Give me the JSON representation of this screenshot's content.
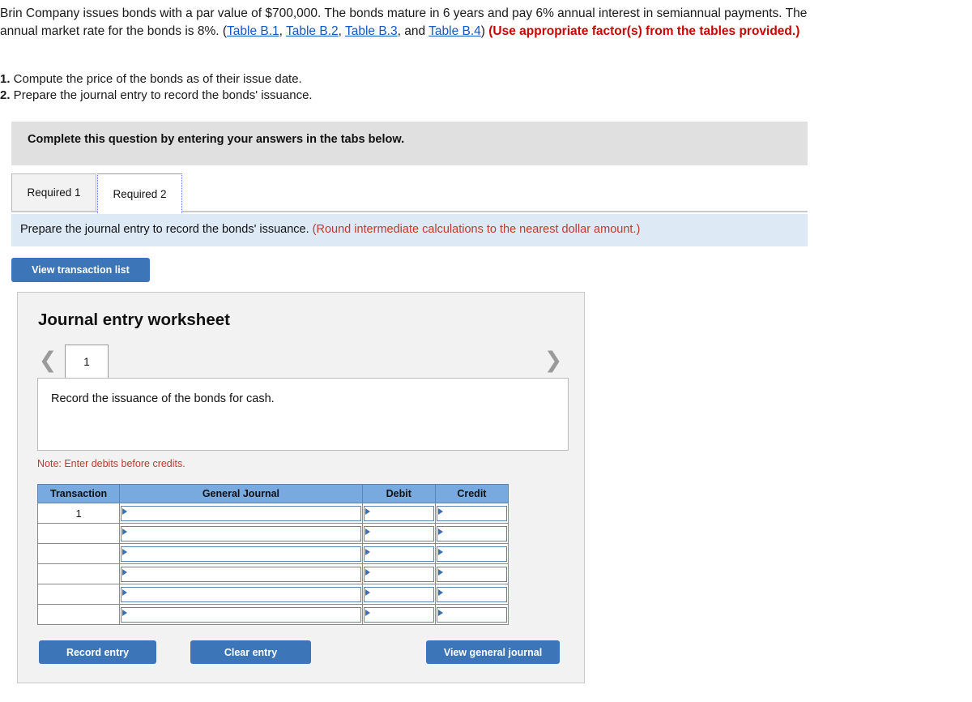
{
  "problem": {
    "part1": "Brin Company issues bonds with a par value of $700,000. The bonds mature in 6 years and pay 6% annual interest in semiannual payments. The annual market rate for the bonds is 8%. (",
    "link1": "Table B.1",
    "sep1": ", ",
    "link2": "Table B.2",
    "sep2": ", ",
    "link3": "Table B.3",
    "sep3": ", and ",
    "link4": "Table B.4",
    "part2": ") ",
    "emphasis": "(Use appropriate factor(s) from the tables provided.)"
  },
  "requirements": [
    {
      "num": "1.",
      "text": " Compute the price of the bonds as of their issue date."
    },
    {
      "num": "2.",
      "text": " Prepare the journal entry to record the bonds' issuance."
    }
  ],
  "complete_bar": {
    "text": "Complete this question by entering your answers in the tabs below."
  },
  "tabs": [
    {
      "label": "Required 1",
      "active": false
    },
    {
      "label": "Required 2",
      "active": true
    }
  ],
  "blue_bar": {
    "text": "Prepare the journal entry to record the bonds' issuance. ",
    "round_note": "(Round intermediate calculations to the nearest dollar amount.)"
  },
  "buttons": {
    "view_transaction_list": "View transaction list",
    "record_entry": "Record entry",
    "clear_entry": "Clear entry",
    "view_general_journal": "View general journal"
  },
  "worksheet": {
    "title": "Journal entry worksheet",
    "prev_icon": "chevron-left",
    "next_icon": "chevron-right",
    "page_tab": "1",
    "description": "Record the issuance of the bonds for cash.",
    "note": "Note: Enter debits before credits.",
    "columns": [
      "Transaction",
      "General Journal",
      "Debit",
      "Credit"
    ],
    "rows": [
      {
        "transaction": "1",
        "general_journal": "",
        "debit": "",
        "credit": ""
      },
      {
        "transaction": "",
        "general_journal": "",
        "debit": "",
        "credit": ""
      },
      {
        "transaction": "",
        "general_journal": "",
        "debit": "",
        "credit": ""
      },
      {
        "transaction": "",
        "general_journal": "",
        "debit": "",
        "credit": ""
      },
      {
        "transaction": "",
        "general_journal": "",
        "debit": "",
        "credit": ""
      },
      {
        "transaction": "",
        "general_journal": "",
        "debit": "",
        "credit": ""
      }
    ]
  },
  "colors": {
    "button_blue": "#3c76b8",
    "table_header_blue": "#78aae0",
    "info_bar_blue": "#ddeaf6",
    "complete_bar_gray": "#e0e0e0",
    "panel_gray": "#f2f2f2",
    "link_blue": "#1257c4",
    "alert_red": "#cc0000",
    "note_red": "#c0392b"
  }
}
